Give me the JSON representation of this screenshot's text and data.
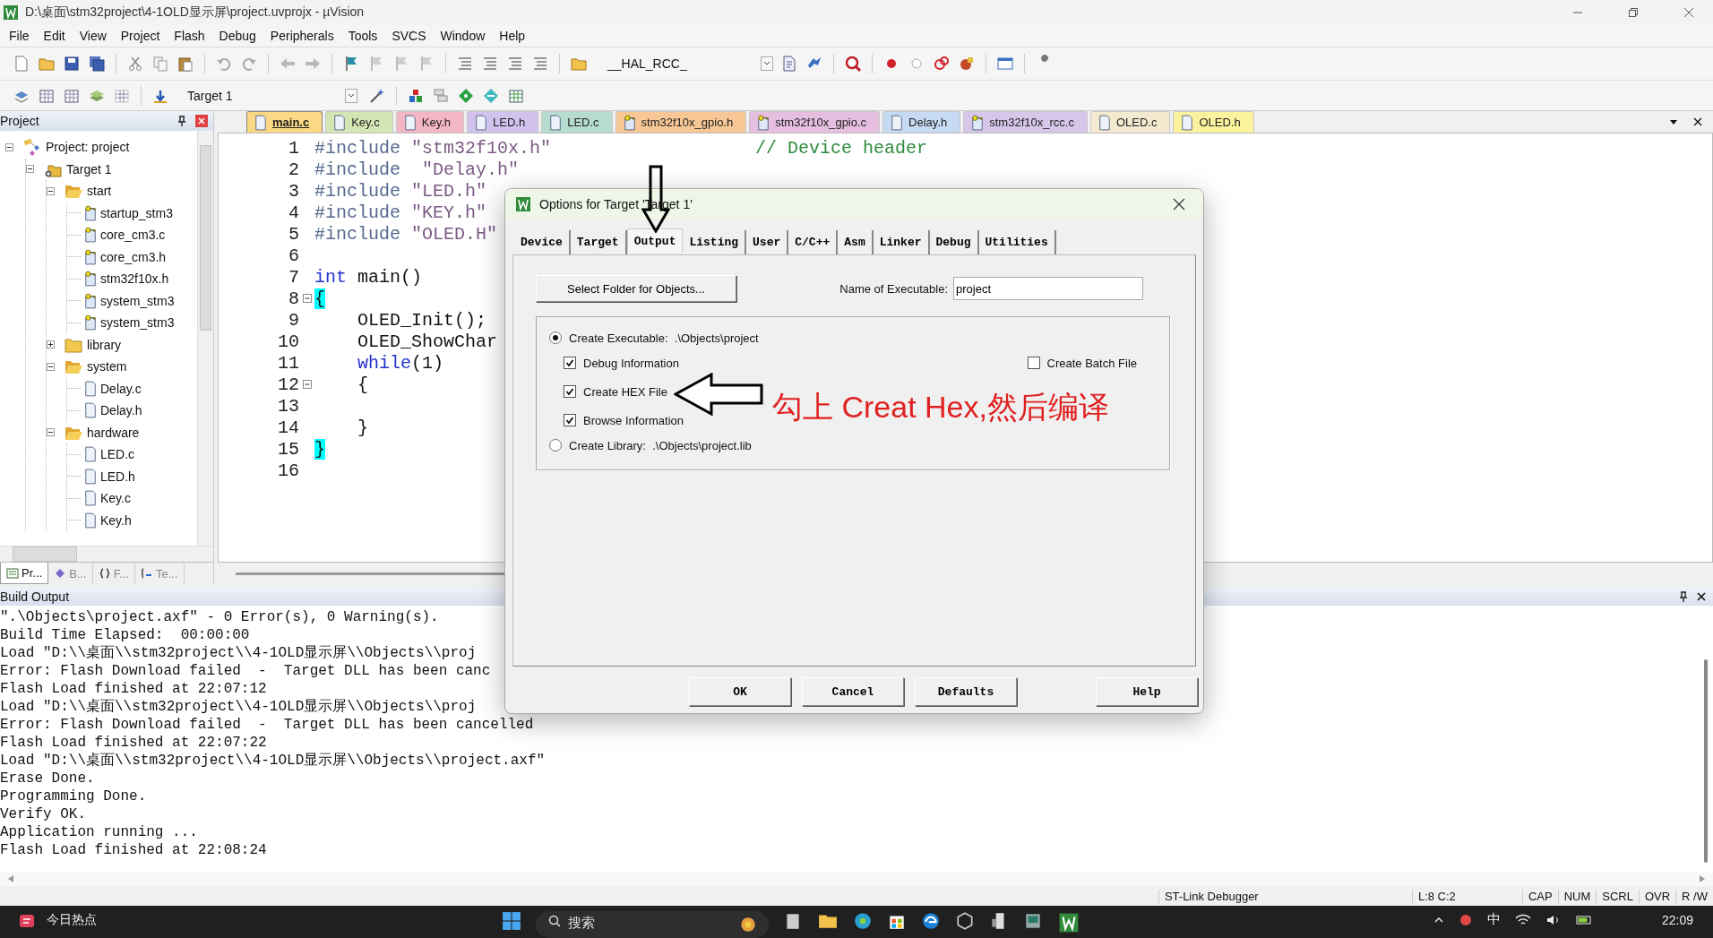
{
  "window": {
    "title": "D:\\桌面\\stm32project\\4-1OLD显示屏\\project.uvprojx - µVision"
  },
  "menu": [
    "File",
    "Edit",
    "View",
    "Project",
    "Flash",
    "Debug",
    "Peripherals",
    "Tools",
    "SVCS",
    "Window",
    "Help"
  ],
  "toolbar": {
    "find_field": "__HAL_RCC_",
    "target_field": "Target 1"
  },
  "project_panel": {
    "title": "Project",
    "tree": [
      {
        "label": "Project: project",
        "kind": "project",
        "expanded": true,
        "children": [
          {
            "label": "Target 1",
            "kind": "target",
            "expanded": true,
            "children": [
              {
                "label": "start",
                "kind": "folder",
                "expanded": true,
                "children": [
                  {
                    "label": "startup_stm3",
                    "kind": "key-file"
                  },
                  {
                    "label": "core_cm3.c",
                    "kind": "key-file"
                  },
                  {
                    "label": "core_cm3.h",
                    "kind": "key-file"
                  },
                  {
                    "label": "stm32f10x.h",
                    "kind": "key-file"
                  },
                  {
                    "label": "system_stm3",
                    "kind": "key-file"
                  },
                  {
                    "label": "system_stm3",
                    "kind": "key-file"
                  }
                ]
              },
              {
                "label": "library",
                "kind": "folder",
                "expanded": false
              },
              {
                "label": "system",
                "kind": "folder",
                "expanded": true,
                "children": [
                  {
                    "label": "Delay.c",
                    "kind": "file"
                  },
                  {
                    "label": "Delay.h",
                    "kind": "file"
                  }
                ]
              },
              {
                "label": "hardware",
                "kind": "folder",
                "expanded": true,
                "children": [
                  {
                    "label": "LED.c",
                    "kind": "file"
                  },
                  {
                    "label": "LED.h",
                    "kind": "file"
                  },
                  {
                    "label": "Key.c",
                    "kind": "file"
                  },
                  {
                    "label": "Key.h",
                    "kind": "file"
                  }
                ]
              }
            ]
          }
        ]
      }
    ],
    "tabs": [
      {
        "label": "Pr...",
        "kind": "project",
        "selected": true
      },
      {
        "label": "B...",
        "kind": "books",
        "selected": false
      },
      {
        "label": "F...",
        "kind": "functions",
        "selected": false
      },
      {
        "label": "Te...",
        "kind": "templates",
        "selected": false
      }
    ]
  },
  "editor": {
    "tabs": [
      {
        "label": "main.c",
        "kind": "file",
        "color": "#fbd984",
        "selected": true
      },
      {
        "label": "Key.c",
        "kind": "file",
        "color": "#d5e6b5",
        "selected": false
      },
      {
        "label": "Key.h",
        "kind": "file",
        "color": "#f3b6c4",
        "selected": false
      },
      {
        "label": "LED.h",
        "kind": "file",
        "color": "#d2c3ee",
        "selected": false
      },
      {
        "label": "LED.c",
        "kind": "file",
        "color": "#b6dccf",
        "selected": false
      },
      {
        "label": "stm32f10x_gpio.h",
        "kind": "key-file",
        "color": "#f7c796",
        "selected": false
      },
      {
        "label": "stm32f10x_gpio.c",
        "kind": "key-file",
        "color": "#e6bfe0",
        "selected": false
      },
      {
        "label": "Delay.h",
        "kind": "file",
        "color": "#c6daf3",
        "selected": false
      },
      {
        "label": "stm32f10x_rcc.c",
        "kind": "key-file",
        "color": "#d6c6ea",
        "selected": false
      },
      {
        "label": "OLED.c",
        "kind": "file",
        "color": "#f3ead0",
        "selected": false
      },
      {
        "label": "OLED.h",
        "kind": "file",
        "color": "#faf29c",
        "selected": false
      }
    ],
    "lines": [
      {
        "number": "1",
        "tokens": [
          {
            "kind": "directive",
            "text": "#include"
          },
          {
            "kind": "string",
            "text": " \"stm32f10x.h\""
          }
        ],
        "comment": "// Device header"
      },
      {
        "number": "2",
        "tokens": [
          {
            "kind": "directive",
            "text": "#include"
          },
          {
            "kind": "string",
            "text": "  \"Delay.h\""
          }
        ]
      },
      {
        "number": "3",
        "tokens": [
          {
            "kind": "directive",
            "text": "#include"
          },
          {
            "kind": "string",
            "text": " \"LED.h\""
          }
        ]
      },
      {
        "number": "4",
        "tokens": [
          {
            "kind": "directive",
            "text": "#include"
          },
          {
            "kind": "string",
            "text": " \"KEY.h\""
          }
        ]
      },
      {
        "number": "5",
        "tokens": [
          {
            "kind": "directive",
            "text": "#include"
          },
          {
            "kind": "string",
            "text": " \"OLED.H\""
          }
        ]
      },
      {
        "number": "6"
      },
      {
        "number": "7",
        "tokens": [
          {
            "kind": "keyword",
            "text": "int"
          },
          {
            "kind": "plain",
            "text": " main()"
          }
        ]
      },
      {
        "number": "8",
        "collapsible": true,
        "tokens": [
          {
            "kind": "brace-match",
            "text": "{"
          }
        ]
      },
      {
        "number": "9",
        "tokens": [
          {
            "kind": "plain",
            "text": "    OLED_Init();"
          }
        ]
      },
      {
        "number": "10",
        "tokens": [
          {
            "kind": "plain",
            "text": "    OLED_ShowChar"
          }
        ]
      },
      {
        "number": "11",
        "tokens": [
          {
            "kind": "keyword",
            "text": "    while"
          },
          {
            "kind": "plain",
            "text": "(1)"
          }
        ]
      },
      {
        "number": "12",
        "collapsible": true,
        "tokens": [
          {
            "kind": "plain",
            "text": "    {"
          }
        ]
      },
      {
        "number": "13"
      },
      {
        "number": "14",
        "tokens": [
          {
            "kind": "plain",
            "text": "    }"
          }
        ]
      },
      {
        "number": "15",
        "tokens": [
          {
            "kind": "brace-match",
            "text": "}"
          }
        ]
      },
      {
        "number": "16"
      }
    ]
  },
  "dialog": {
    "title": "Options for Target 'Target 1'",
    "tabs": [
      {
        "label": "Device",
        "selected": false
      },
      {
        "label": "Target",
        "selected": false
      },
      {
        "label": "Output",
        "selected": true
      },
      {
        "label": "Listing",
        "selected": false
      },
      {
        "label": "User",
        "selected": false
      },
      {
        "label": "C/C++",
        "selected": false
      },
      {
        "label": "Asm",
        "selected": false
      },
      {
        "label": "Linker",
        "selected": false
      },
      {
        "label": "Debug",
        "selected": false
      },
      {
        "label": "Utilities",
        "selected": false
      }
    ],
    "select_folder_button": "Select Folder for Objects...",
    "executable_name": {
      "label": "Name of Executable:",
      "value": "project"
    },
    "create_executable": {
      "label": "Create Executable:  .\\Objects\\project",
      "selected": true
    },
    "options": [
      {
        "label": "Debug Information",
        "checked": true
      },
      {
        "label": "Create HEX File",
        "checked": true
      },
      {
        "label": "Browse Information",
        "checked": true
      }
    ],
    "batch_file": {
      "label": "Create Batch File",
      "checked": false
    },
    "create_library": {
      "label": "Create Library:  .\\Objects\\project.lib",
      "selected": false
    },
    "buttons": [
      "OK",
      "Cancel",
      "Defaults",
      "Help"
    ]
  },
  "annotation": {
    "text": "勾上 Creat Hex,然后编译"
  },
  "build_output": {
    "title": "Build Output",
    "lines": [
      "\".\\Objects\\project.axf\" - 0 Error(s), 0 Warning(s).",
      "Build Time Elapsed:  00:00:00",
      "Load \"D:\\\\桌面\\\\stm32project\\\\4-1OLD显示屏\\\\Objects\\\\proj",
      "Error: Flash Download failed  -  Target DLL has been canc",
      "Flash Load finished at 22:07:12",
      "Load \"D:\\\\桌面\\\\stm32project\\\\4-1OLD显示屏\\\\Objects\\\\proj",
      "Error: Flash Download failed  -  Target DLL has been cancelled",
      "Flash Load finished at 22:07:22",
      "Load \"D:\\\\桌面\\\\stm32project\\\\4-1OLD显示屏\\\\Objects\\\\project.axf\"",
      "Erase Done.",
      "Programming Done.",
      "Verify OK.",
      "Application running ...",
      "Flash Load finished at 22:08:24"
    ]
  },
  "status_bar": {
    "debugger": "ST-Link Debugger",
    "position": "L:8 C:2",
    "indicators": [
      "CAP",
      "NUM",
      "SCRL",
      "OVR",
      "R /W"
    ]
  },
  "taskbar": {
    "widget": "今日热点",
    "search_placeholder": "搜索",
    "input_method": "中",
    "time": "22:09"
  }
}
